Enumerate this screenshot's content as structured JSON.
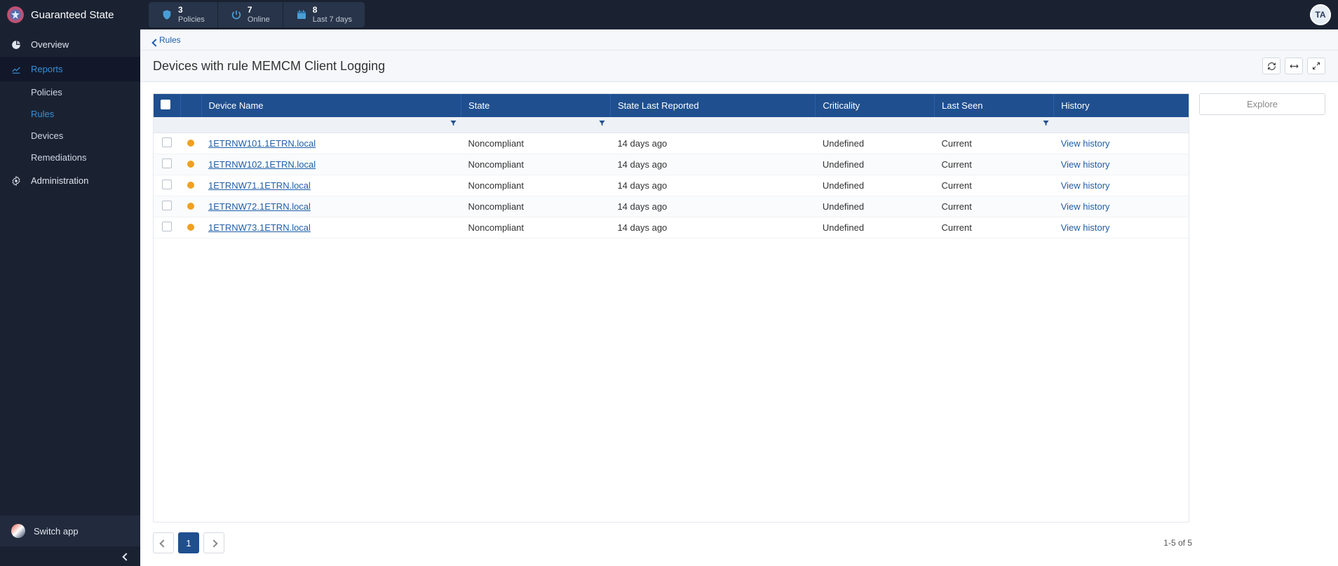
{
  "brand": "Guaranteed State",
  "avatar": "TA",
  "stats": [
    {
      "value": "3",
      "label": "Policies"
    },
    {
      "value": "7",
      "label": "Online"
    },
    {
      "value": "8",
      "label": "Last 7 days"
    }
  ],
  "sidebar": {
    "overview": "Overview",
    "reports": "Reports",
    "sub": {
      "policies": "Policies",
      "rules": "Rules",
      "devices": "Devices",
      "remediations": "Remediations"
    },
    "administration": "Administration",
    "switch_app": "Switch app"
  },
  "breadcrumb": {
    "rules": "Rules"
  },
  "page_title": "Devices with rule MEMCM Client Logging",
  "explore_label": "Explore",
  "table": {
    "headers": {
      "device_name": "Device Name",
      "state": "State",
      "state_last_reported": "State Last Reported",
      "criticality": "Criticality",
      "last_seen": "Last Seen",
      "history": "History"
    },
    "rows": [
      {
        "device": "1ETRNW101.1ETRN.local",
        "state": "Noncompliant",
        "reported": "14 days ago",
        "criticality": "Undefined",
        "last_seen": "Current",
        "history": "View history"
      },
      {
        "device": "1ETRNW102.1ETRN.local",
        "state": "Noncompliant",
        "reported": "14 days ago",
        "criticality": "Undefined",
        "last_seen": "Current",
        "history": "View history"
      },
      {
        "device": "1ETRNW71.1ETRN.local",
        "state": "Noncompliant",
        "reported": "14 days ago",
        "criticality": "Undefined",
        "last_seen": "Current",
        "history": "View history"
      },
      {
        "device": "1ETRNW72.1ETRN.local",
        "state": "Noncompliant",
        "reported": "14 days ago",
        "criticality": "Undefined",
        "last_seen": "Current",
        "history": "View history"
      },
      {
        "device": "1ETRNW73.1ETRN.local",
        "state": "Noncompliant",
        "reported": "14 days ago",
        "criticality": "Undefined",
        "last_seen": "Current",
        "history": "View history"
      }
    ]
  },
  "pagination": {
    "current": "1",
    "info": "1-5 of 5"
  }
}
